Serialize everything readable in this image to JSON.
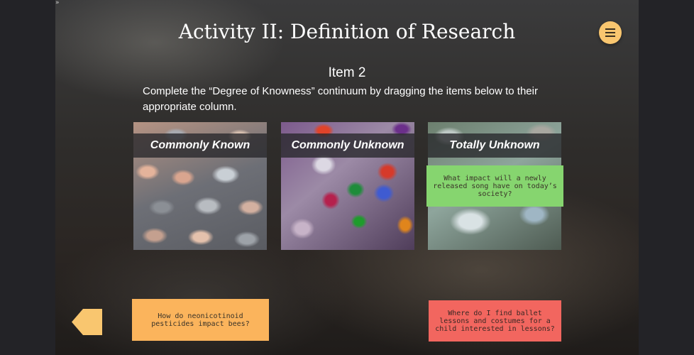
{
  "corner_toggle_label": "»",
  "title": "Activity II: Definition of Research",
  "menu": {
    "icon": "hamburger-menu-icon",
    "color": "#f9c66f"
  },
  "item_label": "Item 2",
  "instructions": "Complete the “Degree of Knowness” continuum by dragging the items below to their appropriate column.",
  "columns": [
    {
      "label": "Commonly Known",
      "image": "pebbles"
    },
    {
      "label": "Commonly Unknown",
      "image": "gemstones"
    },
    {
      "label": "Totally Unknown",
      "image": "crystals"
    }
  ],
  "cards": [
    {
      "text": "What impact will a newly released song have on today’s society?",
      "color": "#86d56f",
      "placed_in": "Totally Unknown"
    },
    {
      "text": "How do neonicotinoid pesticides impact bees?",
      "color": "#fbb45c",
      "placed_in": null
    },
    {
      "text": "Where do I find ballet lessons and costumes for a child interested in lessons?",
      "color": "#f2665f",
      "placed_in": null
    }
  ],
  "back_button": {
    "icon": "arrow-left-icon",
    "color": "#f9c66f"
  }
}
